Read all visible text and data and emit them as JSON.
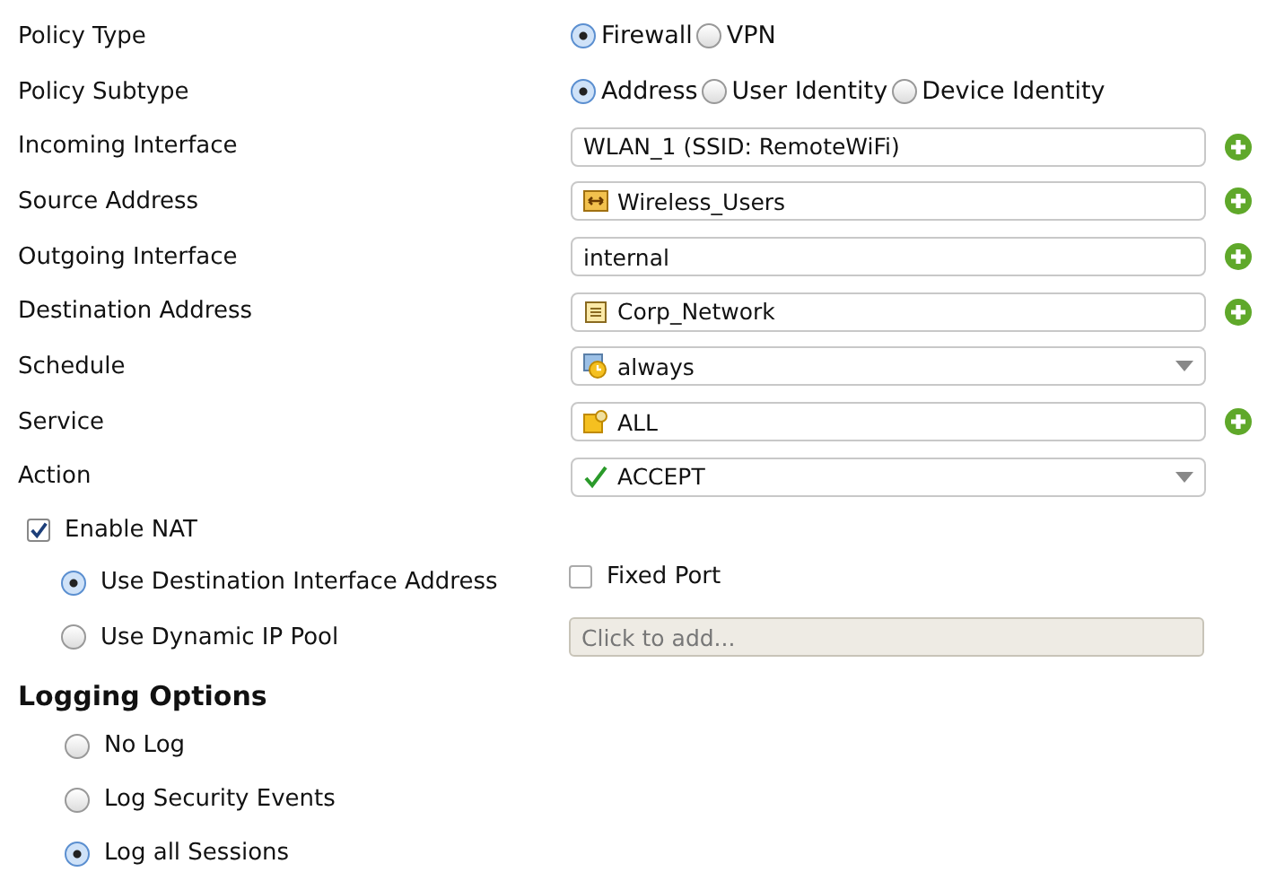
{
  "policy_type": {
    "label": "Policy Type",
    "options": [
      {
        "label": "Firewall",
        "selected": true
      },
      {
        "label": "VPN",
        "selected": false
      }
    ]
  },
  "policy_subtype": {
    "label": "Policy Subtype",
    "options": [
      {
        "label": "Address",
        "selected": true
      },
      {
        "label": "User Identity",
        "selected": false
      },
      {
        "label": "Device Identity",
        "selected": false
      }
    ]
  },
  "fields": [
    {
      "label": "Incoming Interface",
      "kind": "text",
      "value": "WLAN_1 (SSID: RemoteWiFi)",
      "add": true
    },
    {
      "label": "Source Address",
      "kind": "text",
      "value": "Wireless_Users",
      "add": true
    },
    {
      "label": "Outgoing Interface",
      "kind": "text",
      "value": "internal",
      "add": true
    },
    {
      "label": "Destination Address",
      "kind": "text",
      "value": "Corp_Network",
      "add": true
    },
    {
      "label": "Schedule",
      "kind": "select",
      "value": "always",
      "add": false
    },
    {
      "label": "Service",
      "kind": "text",
      "value": "ALL",
      "add": true
    },
    {
      "label": "Action",
      "kind": "select",
      "value": "ACCEPT",
      "add": false
    }
  ],
  "nat": {
    "enable": {
      "label": "Enable NAT",
      "checked": true
    },
    "options": [
      {
        "label": "Use Destination Interface Address",
        "selected": true
      },
      {
        "label": "Use Dynamic IP Pool",
        "selected": false
      }
    ],
    "fixed_port": {
      "label": "Fixed Port",
      "checked": false
    },
    "pool_field": {
      "placeholder": "Click to add..."
    }
  },
  "logging": {
    "title": "Logging Options",
    "options": [
      {
        "label": "No Log",
        "selected": false
      },
      {
        "label": "Log Security Events",
        "selected": false
      },
      {
        "label": "Log all Sessions",
        "selected": true
      }
    ]
  }
}
